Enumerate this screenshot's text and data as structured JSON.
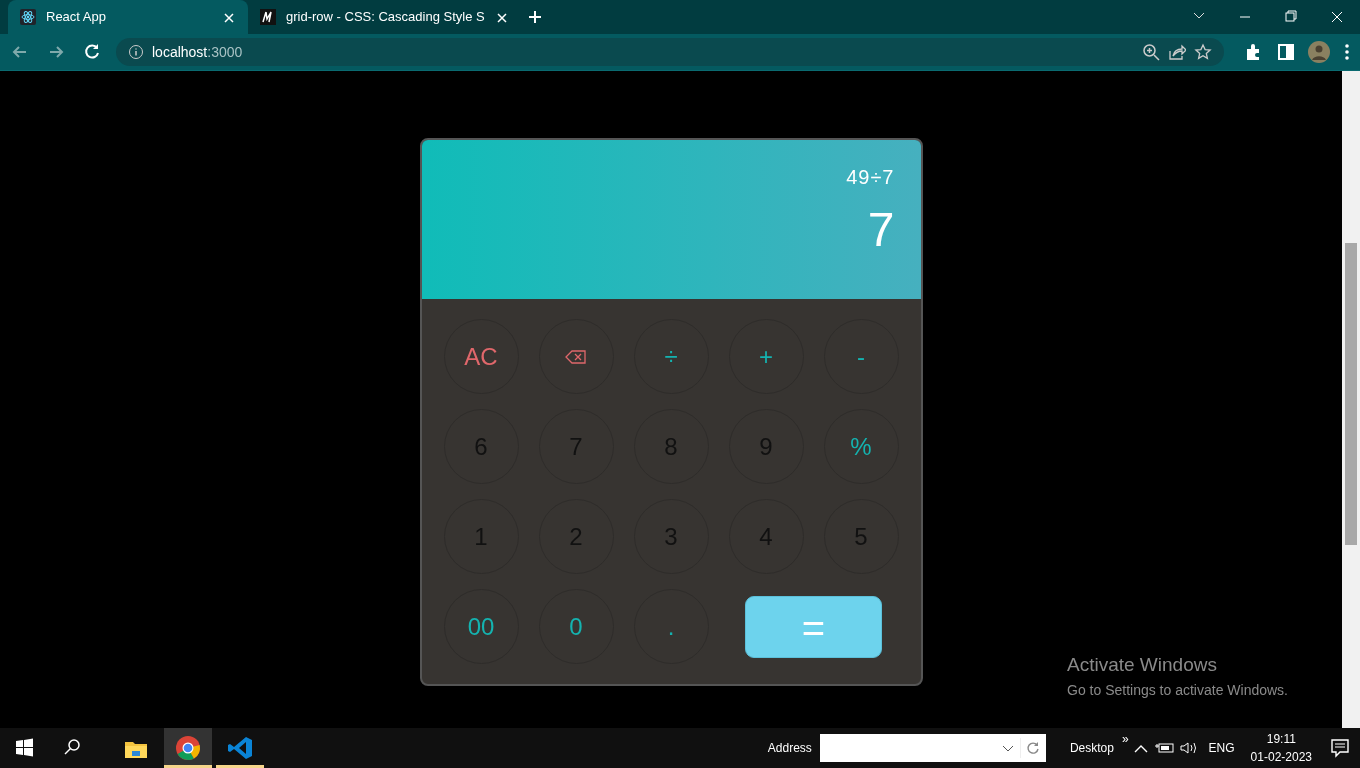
{
  "browser": {
    "tabs": [
      {
        "title": "React App",
        "selected": true
      },
      {
        "title": "grid-row - CSS: Cascading Style S",
        "selected": false
      }
    ],
    "address": {
      "host": "localhost",
      "port": ":3000"
    }
  },
  "calculator": {
    "expression": "49÷7",
    "result": "7",
    "keys": [
      {
        "kind": "danger",
        "label": "AC"
      },
      {
        "kind": "backspace"
      },
      {
        "kind": "accent",
        "label": "÷"
      },
      {
        "kind": "accent",
        "label": "+"
      },
      {
        "kind": "accent",
        "label": "-"
      },
      {
        "kind": "plain",
        "label": "6"
      },
      {
        "kind": "plain",
        "label": "7"
      },
      {
        "kind": "plain",
        "label": "8"
      },
      {
        "kind": "plain",
        "label": "9"
      },
      {
        "kind": "accent",
        "label": "%"
      },
      {
        "kind": "plain",
        "label": "1"
      },
      {
        "kind": "plain",
        "label": "2"
      },
      {
        "kind": "plain",
        "label": "3"
      },
      {
        "kind": "plain",
        "label": "4"
      },
      {
        "kind": "plain",
        "label": "5"
      },
      {
        "kind": "accent",
        "label": "00"
      },
      {
        "kind": "accent",
        "label": "0"
      },
      {
        "kind": "accent",
        "label": "."
      },
      {
        "kind": "equals",
        "label": "="
      }
    ]
  },
  "activation_notice": {
    "title": "Activate Windows",
    "text": "Go to Settings to activate Windows."
  },
  "taskbar": {
    "apps": [
      {
        "selected": false,
        "running": false
      },
      {
        "selected": true,
        "running": true
      },
      {
        "selected": false,
        "running": true
      }
    ],
    "address_label": "Address",
    "desktop_label": "Desktop",
    "chevron": "»",
    "language": "ENG",
    "time": "19:11",
    "date": "01-02-2023"
  }
}
